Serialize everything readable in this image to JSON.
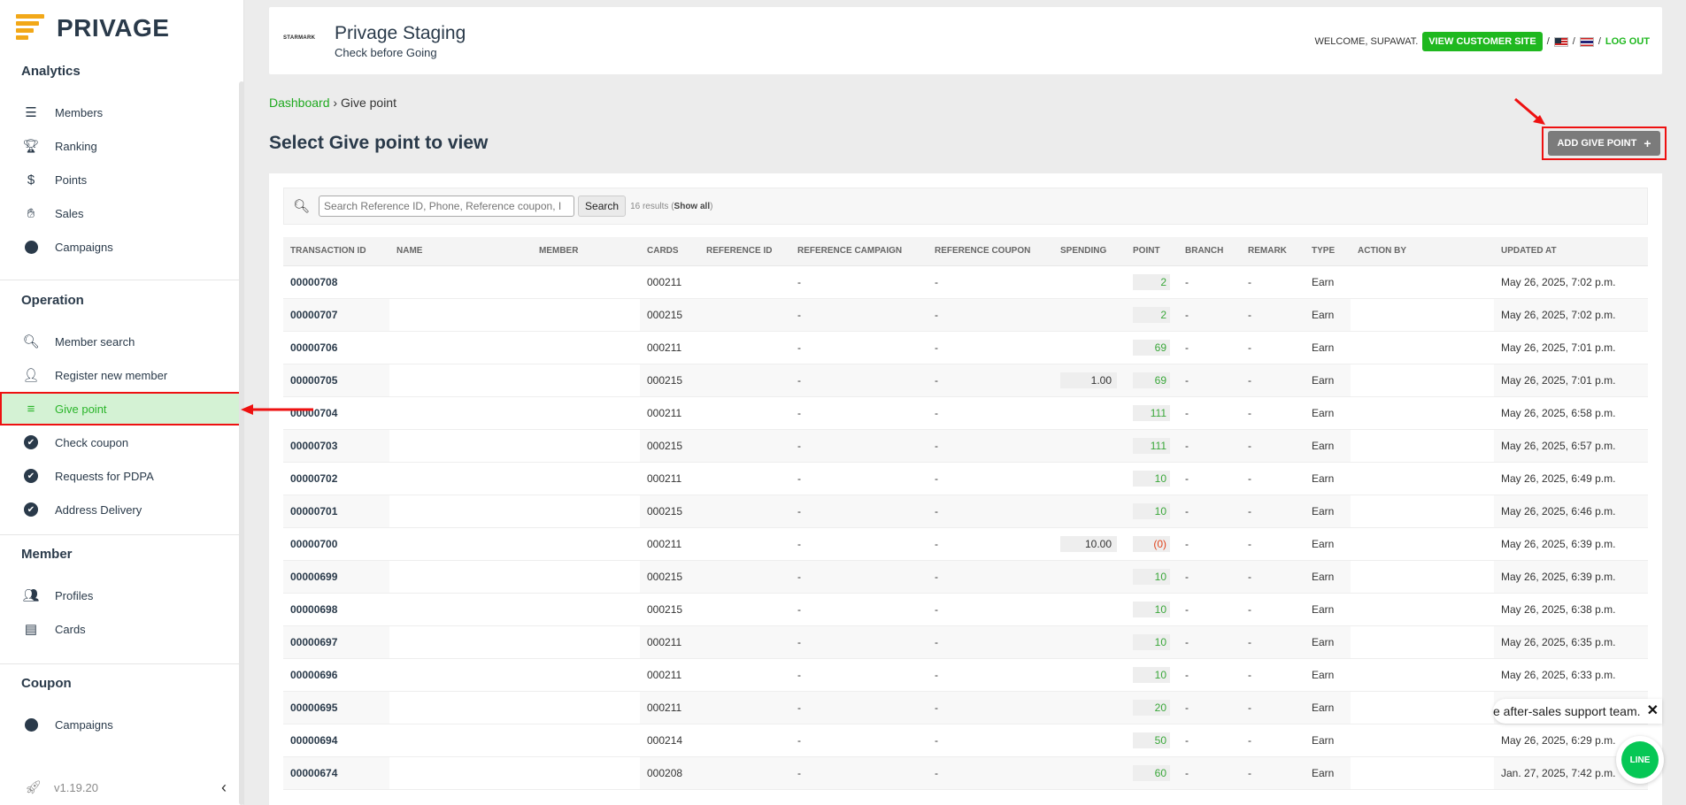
{
  "app": {
    "name": "PRIVAGE",
    "version": "v1.19.20"
  },
  "sidebar": {
    "sections": [
      {
        "title": "Analytics",
        "items": [
          {
            "label": "Members",
            "icon": "bar-chart-icon"
          },
          {
            "label": "Ranking",
            "icon": "trophy-icon"
          },
          {
            "label": "Points",
            "icon": "coins-icon"
          },
          {
            "label": "Sales",
            "icon": "hand-money-icon"
          },
          {
            "label": "Campaigns",
            "icon": "badge-icon"
          }
        ]
      },
      {
        "title": "Operation",
        "items": [
          {
            "label": "Member search",
            "icon": "search-icon"
          },
          {
            "label": "Register new member",
            "icon": "user-plus-icon"
          },
          {
            "label": "Give point",
            "icon": "list-icon",
            "active": true
          },
          {
            "label": "Check coupon",
            "icon": "check-circle-icon"
          },
          {
            "label": "Requests for PDPA",
            "icon": "check-circle-icon"
          },
          {
            "label": "Address Delivery",
            "icon": "check-circle-icon"
          }
        ]
      },
      {
        "title": "Member",
        "items": [
          {
            "label": "Profiles",
            "icon": "users-icon"
          },
          {
            "label": "Cards",
            "icon": "id-card-icon"
          }
        ]
      },
      {
        "title": "Coupon",
        "items": [
          {
            "label": "Campaigns",
            "icon": "badge-icon"
          }
        ]
      }
    ]
  },
  "header": {
    "brand_logo": "STARMARK",
    "site_title": "Privage Staging",
    "site_subtitle": "Check before Going",
    "welcome": "WELCOME, SUPAWAT.",
    "view_site": "VIEW CUSTOMER SITE",
    "sep": "/",
    "logout": "LOG OUT"
  },
  "breadcrumb": {
    "root": "Dashboard",
    "sep": "›",
    "current": "Give point"
  },
  "page": {
    "title": "Select Give point to view",
    "add_button": "ADD GIVE POINT"
  },
  "search": {
    "placeholder": "Search Reference ID, Phone, Reference coupon, I",
    "button": "Search",
    "results_count": "16 results (",
    "show_all": "Show all",
    "results_close": ")"
  },
  "table": {
    "columns": [
      "Transaction ID",
      "Name",
      "Member",
      "Cards",
      "Reference ID",
      "Reference Campaign",
      "Reference Coupon",
      "Spending",
      "Point",
      "Branch",
      "Remark",
      "Type",
      "Action by",
      "Updated at"
    ],
    "rows": [
      {
        "id": "00000708",
        "card": "000211",
        "ref_campaign": "-",
        "ref_coupon": "-",
        "spending": "",
        "point": "2",
        "branch": "-",
        "remark": "-",
        "type": "Earn",
        "updated": "May 26, 2025, 7:02 p.m."
      },
      {
        "id": "00000707",
        "card": "000215",
        "ref_campaign": "-",
        "ref_coupon": "-",
        "spending": "",
        "point": "2",
        "branch": "-",
        "remark": "-",
        "type": "Earn",
        "updated": "May 26, 2025, 7:02 p.m."
      },
      {
        "id": "00000706",
        "card": "000211",
        "ref_campaign": "-",
        "ref_coupon": "-",
        "spending": "",
        "point": "69",
        "branch": "-",
        "remark": "-",
        "type": "Earn",
        "updated": "May 26, 2025, 7:01 p.m."
      },
      {
        "id": "00000705",
        "card": "000215",
        "ref_campaign": "-",
        "ref_coupon": "-",
        "spending": "1.00",
        "point": "69",
        "branch": "-",
        "remark": "-",
        "type": "Earn",
        "updated": "May 26, 2025, 7:01 p.m."
      },
      {
        "id": "00000704",
        "card": "000211",
        "ref_campaign": "-",
        "ref_coupon": "-",
        "spending": "",
        "point": "111",
        "branch": "-",
        "remark": "-",
        "type": "Earn",
        "updated": "May 26, 2025, 6:58 p.m."
      },
      {
        "id": "00000703",
        "card": "000215",
        "ref_campaign": "-",
        "ref_coupon": "-",
        "spending": "",
        "point": "111",
        "branch": "-",
        "remark": "-",
        "type": "Earn",
        "updated": "May 26, 2025, 6:57 p.m."
      },
      {
        "id": "00000702",
        "card": "000211",
        "ref_campaign": "-",
        "ref_coupon": "-",
        "spending": "",
        "point": "10",
        "branch": "-",
        "remark": "-",
        "type": "Earn",
        "updated": "May 26, 2025, 6:49 p.m."
      },
      {
        "id": "00000701",
        "card": "000215",
        "ref_campaign": "-",
        "ref_coupon": "-",
        "spending": "",
        "point": "10",
        "branch": "-",
        "remark": "-",
        "type": "Earn",
        "updated": "May 26, 2025, 6:46 p.m."
      },
      {
        "id": "00000700",
        "card": "000211",
        "ref_campaign": "-",
        "ref_coupon": "-",
        "spending": "10.00",
        "point": "(0)",
        "point_negative": true,
        "branch": "-",
        "remark": "-",
        "type": "Earn",
        "updated": "May 26, 2025, 6:39 p.m."
      },
      {
        "id": "00000699",
        "card": "000215",
        "ref_campaign": "-",
        "ref_coupon": "-",
        "spending": "",
        "point": "10",
        "branch": "-",
        "remark": "-",
        "type": "Earn",
        "updated": "May 26, 2025, 6:39 p.m."
      },
      {
        "id": "00000698",
        "card": "000215",
        "ref_campaign": "-",
        "ref_coupon": "-",
        "spending": "",
        "point": "10",
        "branch": "-",
        "remark": "-",
        "type": "Earn",
        "updated": "May 26, 2025, 6:38 p.m."
      },
      {
        "id": "00000697",
        "card": "000211",
        "ref_campaign": "-",
        "ref_coupon": "-",
        "spending": "",
        "point": "10",
        "branch": "-",
        "remark": "-",
        "type": "Earn",
        "updated": "May 26, 2025, 6:35 p.m."
      },
      {
        "id": "00000696",
        "card": "000211",
        "ref_campaign": "-",
        "ref_coupon": "-",
        "spending": "",
        "point": "10",
        "branch": "-",
        "remark": "-",
        "type": "Earn",
        "updated": "May 26, 2025, 6:33 p.m."
      },
      {
        "id": "00000695",
        "card": "000211",
        "ref_campaign": "-",
        "ref_coupon": "-",
        "spending": "",
        "point": "20",
        "branch": "-",
        "remark": "-",
        "type": "Earn",
        "updated": ""
      },
      {
        "id": "00000694",
        "card": "000214",
        "ref_campaign": "-",
        "ref_coupon": "-",
        "spending": "",
        "point": "50",
        "branch": "-",
        "remark": "-",
        "type": "Earn",
        "updated": "May 26, 2025, 6:29 p.m."
      },
      {
        "id": "00000674",
        "card": "000208",
        "ref_campaign": "-",
        "ref_coupon": "-",
        "spending": "",
        "point": "60",
        "branch": "-",
        "remark": "-",
        "type": "Earn",
        "updated": "Jan. 27, 2025, 7:42 p.m."
      }
    ]
  },
  "support": {
    "toast": "e after-sales support team.",
    "line_label": "LINE"
  },
  "colors": {
    "accent_green": "#1fb81f",
    "highlight_red": "#e11111",
    "negative": "#e0441c"
  }
}
